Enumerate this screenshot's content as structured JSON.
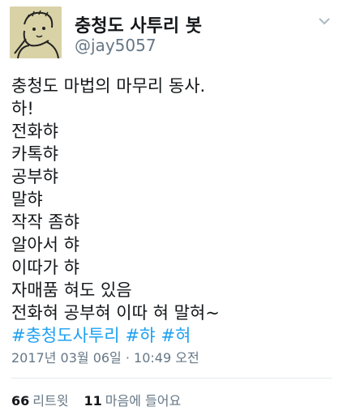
{
  "user": {
    "display_name": "충청도 사투리 봇",
    "handle": "@jay5057"
  },
  "tweet": {
    "lines": [
      "충청도 마법의 마무리 동사.",
      "하!",
      "전화햐",
      "카톡햐",
      "공부햐",
      "말햐",
      "작작 좀햐",
      "알아서 햐",
      "이따가 햐",
      "자매품 혀도 있음",
      "전화혀 공부혀 이따 혀 말혀~"
    ],
    "hashtags": [
      "#충청도사투리",
      "#햐",
      "#혀"
    ],
    "timestamp": "2017년 03월 06일 · 10:49 오전"
  },
  "stats": {
    "retweets_count": "66",
    "retweets_label": "리트윗",
    "likes_count": "11",
    "likes_label": "마음에 들어요"
  },
  "colors": {
    "link": "#1da1f2",
    "muted": "#657786",
    "text": "#14171a"
  }
}
